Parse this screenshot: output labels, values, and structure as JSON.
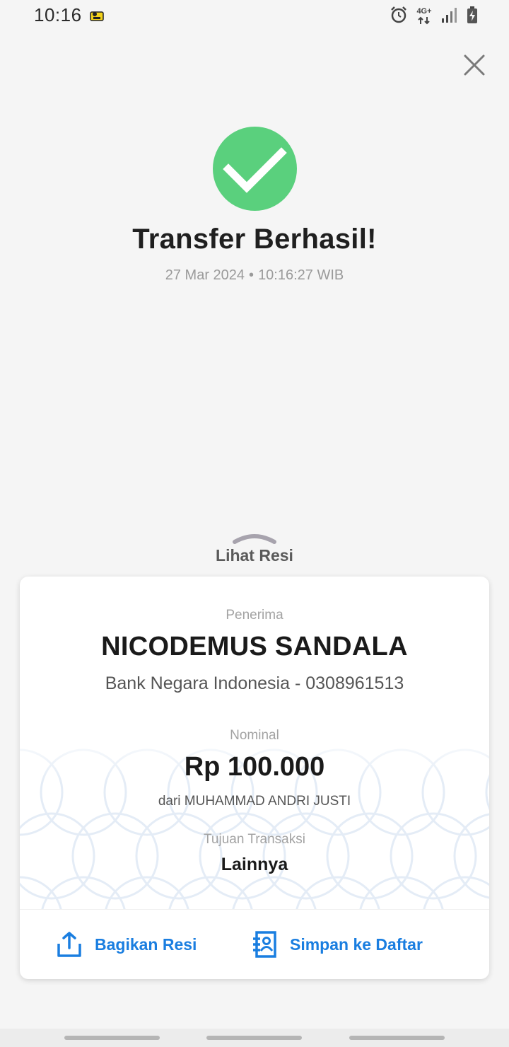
{
  "status_bar": {
    "time": "10:16",
    "network_label": "4G+"
  },
  "header": {
    "close_icon": "close-icon"
  },
  "result": {
    "title": "Transfer Berhasil!",
    "date": "27 Mar 2024",
    "separator": "•",
    "time": "10:16:27 WIB",
    "status_color": "#5ad07d"
  },
  "receipt_toggle": {
    "label": "Lihat Resi"
  },
  "receipt": {
    "recipient_label": "Penerima",
    "recipient_name": "NICODEMUS SANDALA",
    "recipient_bank": "Bank Negara Indonesia - 0308961513",
    "amount_label": "Nominal",
    "amount": "Rp 100.000",
    "sender": "dari MUHAMMAD ANDRI JUSTI",
    "purpose_label": "Tujuan Transaksi",
    "purpose": "Lainnya"
  },
  "actions": {
    "share_label": "Bagikan Resi",
    "share_icon": "share-icon",
    "save_label": "Simpan ke Daftar",
    "save_icon": "contact-book-icon",
    "accent_color": "#1a7ee0"
  }
}
